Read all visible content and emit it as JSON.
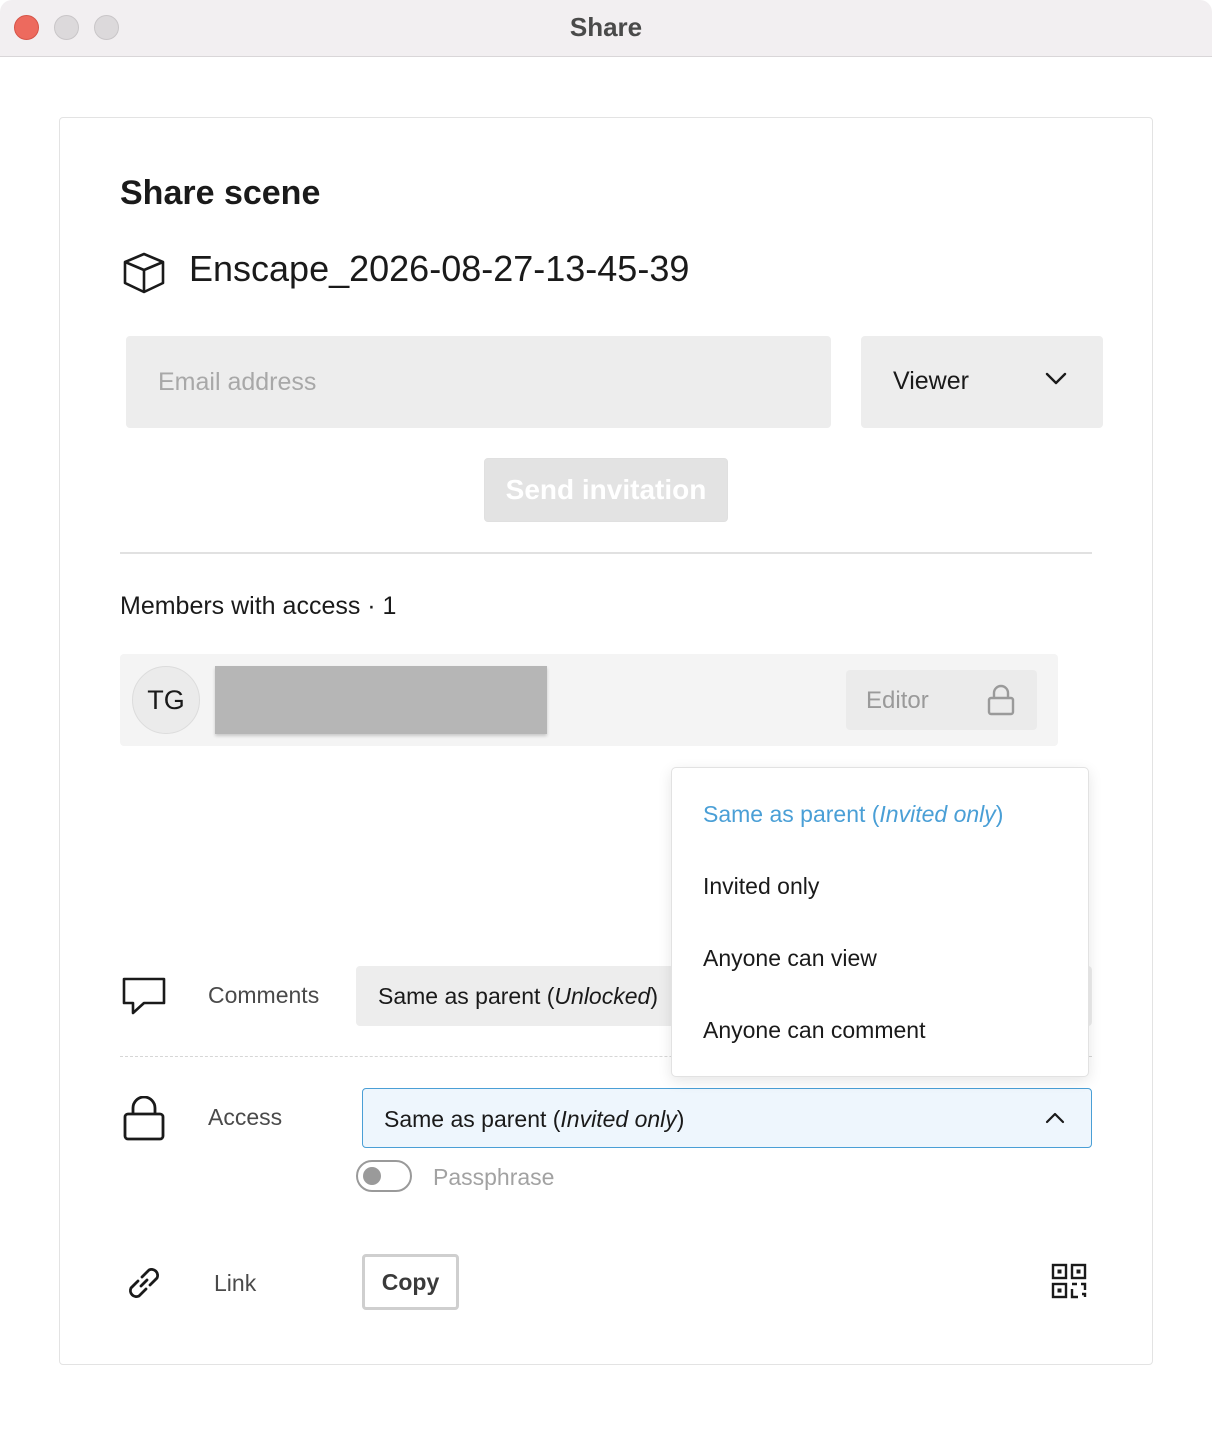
{
  "window": {
    "title": "Share"
  },
  "dialog": {
    "heading": "Share scene",
    "scene_icon": "cube-icon",
    "scene_name": "Enscape_2026-08-27-13-45-39"
  },
  "invite": {
    "email_placeholder": "Email address",
    "email_value": "",
    "role_selected": "Viewer",
    "send_label": "Send invitation"
  },
  "members": {
    "title": "Members with access · 1",
    "items": [
      {
        "initials": "TG",
        "role": "Editor",
        "role_locked": true
      }
    ]
  },
  "settings": {
    "comments": {
      "icon": "chat-bubble-icon",
      "label": "Comments",
      "value_prefix": "Same as parent (",
      "value_emphasis": "Unlocked",
      "value_suffix": ")"
    },
    "access": {
      "icon": "lock-icon",
      "label": "Access",
      "value_prefix": "Same as parent (",
      "value_emphasis": "Invited only",
      "value_suffix": ")",
      "expanded": true,
      "options": [
        {
          "prefix": "Same as parent (",
          "emphasis": "Invited only",
          "suffix": ")",
          "selected": true
        },
        {
          "prefix": "Invited only",
          "emphasis": "",
          "suffix": "",
          "selected": false
        },
        {
          "prefix": "Anyone can view",
          "emphasis": "",
          "suffix": "",
          "selected": false
        },
        {
          "prefix": "Anyone can comment",
          "emphasis": "",
          "suffix": "",
          "selected": false
        }
      ]
    },
    "passphrase": {
      "label": "Passphrase",
      "enabled": false
    },
    "link": {
      "icon": "link-icon",
      "label": "Link",
      "copy_label": "Copy",
      "qr_icon": "qr-code-icon"
    }
  },
  "colors": {
    "accent": "#4a9fd6",
    "close_button": "#ed6a5e",
    "field_background": "#ededed"
  }
}
